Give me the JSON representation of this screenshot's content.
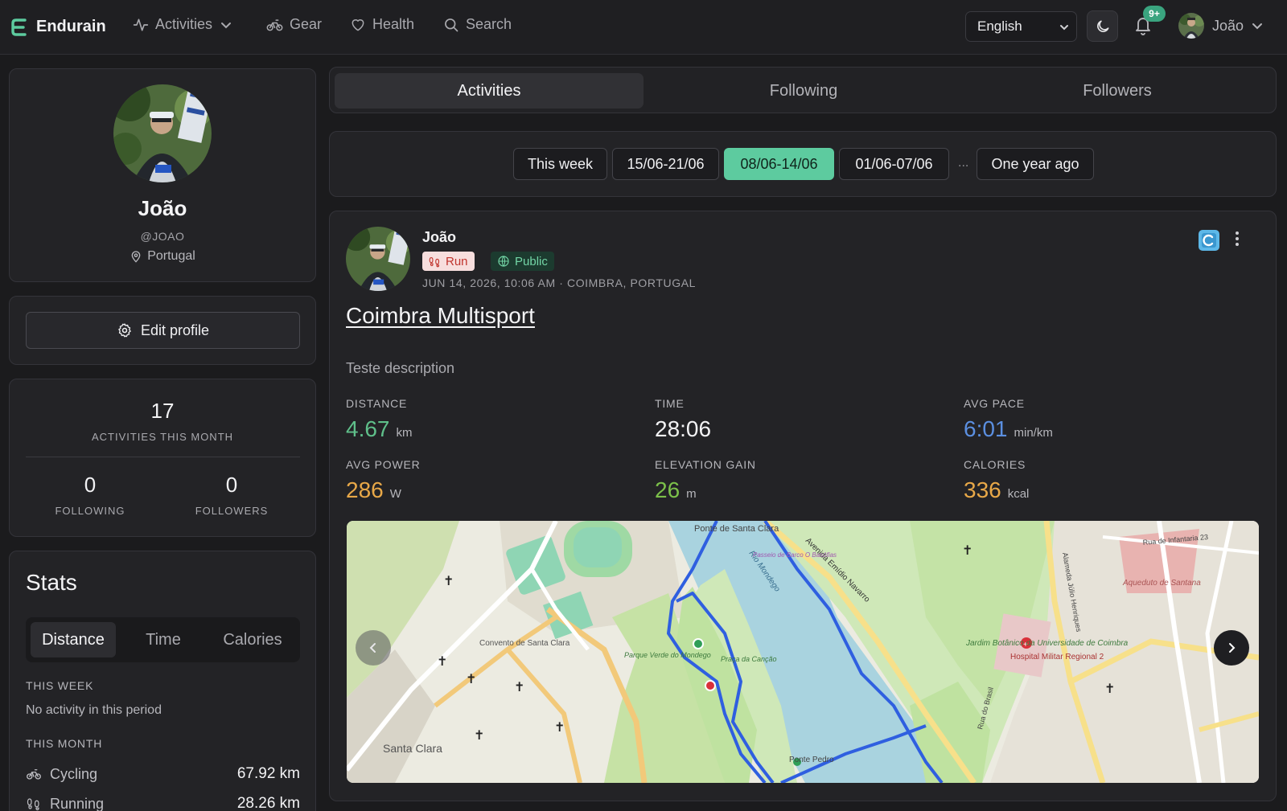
{
  "navbar": {
    "brand": "Endurain",
    "items": [
      {
        "label": "Activities",
        "icon": "activity-icon"
      },
      {
        "label": "Gear",
        "icon": "bike-icon"
      },
      {
        "label": "Health",
        "icon": "heart-icon"
      },
      {
        "label": "Search",
        "icon": "search-icon"
      }
    ],
    "language": "English",
    "notifications_badge": "9+",
    "user_name": "João"
  },
  "profile": {
    "name": "João",
    "handle": "@JOAO",
    "location": "Portugal",
    "edit_label": "Edit profile"
  },
  "counts": {
    "activities_month": "17",
    "activities_month_label": "ACTIVITIES THIS MONTH",
    "following": "0",
    "following_label": "FOLLOWING",
    "followers": "0",
    "followers_label": "FOLLOWERS"
  },
  "stats": {
    "title": "Stats",
    "tabs": [
      "Distance",
      "Time",
      "Calories"
    ],
    "active_tab": "Distance",
    "this_week_label": "THIS WEEK",
    "this_week_empty": "No activity in this period",
    "this_month_label": "THIS MONTH",
    "this_month": [
      {
        "sport": "Cycling",
        "value": "67.92 km",
        "icon": "bike-icon"
      },
      {
        "sport": "Running",
        "value": "28.26 km",
        "icon": "footprints-icon"
      }
    ]
  },
  "main_tabs": [
    "Activities",
    "Following",
    "Followers"
  ],
  "active_main_tab": "Activities",
  "periods": [
    "This week",
    "15/06-21/06",
    "08/06-14/06",
    "01/06-07/06",
    "...",
    "One year ago"
  ],
  "active_period": "08/06-14/06",
  "activity": {
    "user": "João",
    "type_tag": "Run",
    "visibility_tag": "Public",
    "meta": "JUN 14, 2026, 10:06 AM · COIMBRA, PORTUGAL",
    "title": "Coimbra Multisport",
    "description": "Teste description",
    "metrics": [
      {
        "label": "DISTANCE",
        "value": "4.67",
        "unit": "km",
        "color": "#5fbf8a"
      },
      {
        "label": "TIME",
        "value": "28:06",
        "unit": "",
        "color": "#f2f2f4"
      },
      {
        "label": "AVG PACE",
        "value": "6:01",
        "unit": "min/km",
        "color": "#5b8fe0"
      },
      {
        "label": "AVG POWER",
        "value": "286",
        "unit": "W",
        "color": "#e8a848"
      },
      {
        "label": "ELEVATION GAIN",
        "value": "26",
        "unit": "m",
        "color": "#7cc04a"
      },
      {
        "label": "CALORIES",
        "value": "336",
        "unit": "kcal",
        "color": "#e8a848"
      }
    ],
    "map_labels": {
      "ponte_santa_clara": "Ponte de Santa Clara",
      "convento": "Convento de Santa Clara",
      "santa_clara": "Santa Clara",
      "parque_verde": "Parque Verde do Mondego",
      "praca_cancao": "Praça da Canção",
      "avenida": "Avenida Emídio Navarro",
      "jardim": "Jardim Botânico da Universidade de Coimbra",
      "hospital": "Hospital Militar Regional 2",
      "aqueduto": "Aqueduto de Santana",
      "rio": "Rio Mondego",
      "ponte_pedro": "Ponte Pedro",
      "rua_brasil": "Rua do Brasil",
      "alameda": "Alameda Júlio Henriques",
      "infantaria": "Rua de Infantaria 23",
      "passeio": "Passeio de Barco O Basófias"
    }
  },
  "colors": {
    "accent": "#5dcb9f",
    "route": "#2f5fe0",
    "start_marker": "#2f9e57",
    "end_marker": "#d9303a"
  }
}
